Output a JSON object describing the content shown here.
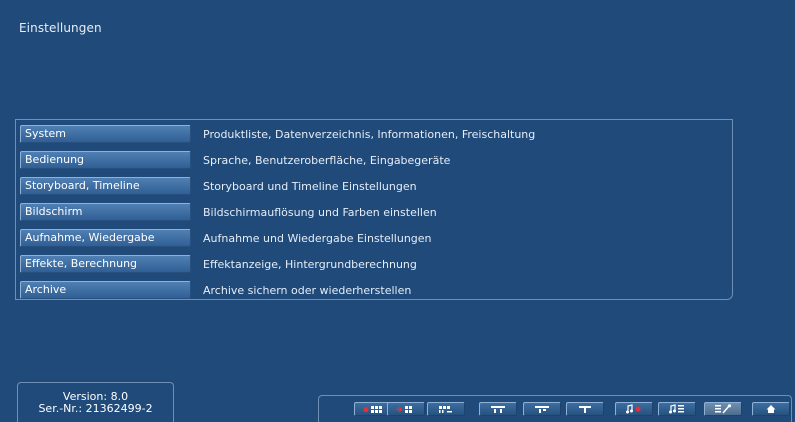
{
  "window": {
    "title": "Einstellungen"
  },
  "menu": {
    "items": [
      {
        "label": "System",
        "description": "Produktliste, Datenverzeichnis, Informationen, Freischaltung"
      },
      {
        "label": "Bedienung",
        "description": "Sprache, Benutzeroberfläche, Eingabegeräte"
      },
      {
        "label": "Storyboard, Timeline",
        "description": "Storyboard und Timeline Einstellungen"
      },
      {
        "label": "Bildschirm",
        "description": "Bildschirmauflösung und Farben einstellen"
      },
      {
        "label": "Aufnahme, Wiedergabe",
        "description": "Aufnahme und Wiedergabe Einstellungen"
      },
      {
        "label": "Effekte, Berechnung",
        "description": "Effektanzeige, Hintergrundberechnung"
      },
      {
        "label": "Archive",
        "description": "Archive sichern oder wiederherstellen"
      }
    ]
  },
  "info": {
    "version": "Version: 8.0",
    "serial": "Ser.-Nr.: 21362499-2"
  },
  "toolbar": {
    "buttons": [
      {
        "icon": "record-storyboard-icon"
      },
      {
        "icon": "import-storyboard-icon"
      },
      {
        "icon": "edit-storyboard-icon"
      },
      {
        "icon": "transition-icon"
      },
      {
        "icon": "effects-icon"
      },
      {
        "icon": "title-icon"
      },
      {
        "icon": "audio-record-icon"
      },
      {
        "icon": "audio-edit-icon"
      },
      {
        "icon": "settings-tools-icon",
        "active": true
      },
      {
        "icon": "home-icon"
      }
    ]
  },
  "colors": {
    "background": "#1f4a7a",
    "button": "#3d6da2",
    "accent_red": "#e0303a",
    "border": "#6f8fb5"
  }
}
